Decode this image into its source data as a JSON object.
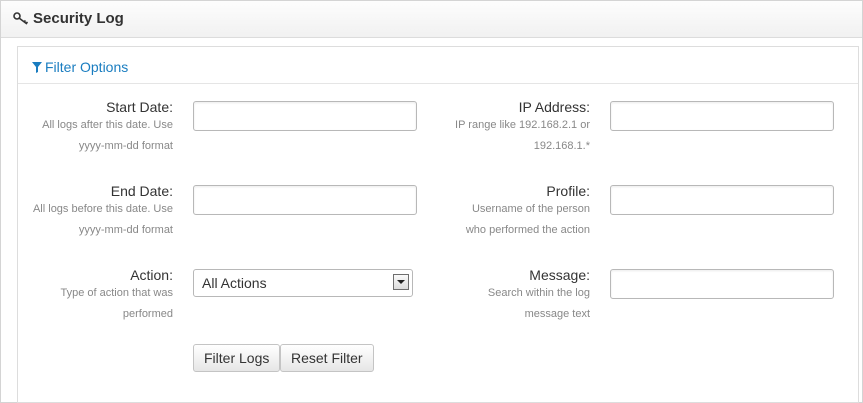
{
  "header": {
    "title": "Security Log",
    "icon": "key-icon"
  },
  "filter": {
    "toggle_label": "Filter Options",
    "icon": "filter-icon",
    "accent": "#1a7dc0"
  },
  "fields": {
    "start_date": {
      "label": "Start Date:",
      "help": [
        "All logs after this date. Use",
        "yyyy-mm-dd format"
      ],
      "value": ""
    },
    "end_date": {
      "label": "End Date:",
      "help": [
        "All logs before this date. Use",
        "yyyy-mm-dd format"
      ],
      "value": ""
    },
    "action": {
      "label": "Action:",
      "help": [
        "Type of action that was",
        "performed"
      ],
      "selected": "All Actions"
    },
    "ip_address": {
      "label": "IP Address:",
      "help": [
        "IP range like 192.168.2.1 or",
        "192.168.1.*"
      ],
      "value": ""
    },
    "profile": {
      "label": "Profile:",
      "help": [
        "Username of the person",
        "who performed the action"
      ],
      "value": ""
    },
    "message": {
      "label": "Message:",
      "help": [
        "Search within the log",
        "message text"
      ],
      "value": ""
    }
  },
  "buttons": {
    "filter": "Filter Logs",
    "reset": "Reset Filter"
  }
}
